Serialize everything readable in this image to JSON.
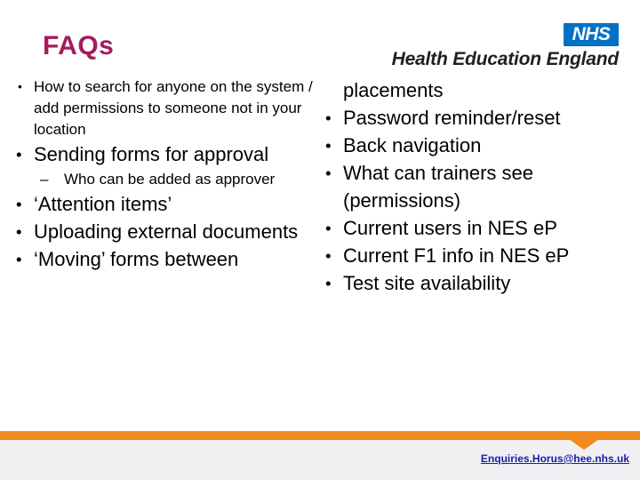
{
  "slide": {
    "title": "FAQs",
    "title_color": "#A51B5E",
    "background_color": "#FFFFFF"
  },
  "logo": {
    "nhs_label": "NHS",
    "organisation": "Health Education England",
    "nhs_blue": "#0072C6"
  },
  "left_column": [
    {
      "level": 1,
      "size": "small",
      "text": "How to search for anyone on the system / add permissions to someone not in your location"
    },
    {
      "level": 1,
      "size": "large",
      "text": "Sending forms for approval"
    },
    {
      "level": 2,
      "size": "small",
      "text": "Who can be added as approver"
    },
    {
      "level": 1,
      "size": "large",
      "text": "‘Attention items’"
    },
    {
      "level": 1,
      "size": "large",
      "text": "Uploading external documents"
    },
    {
      "level": 1,
      "size": "large",
      "text": "‘Moving’ forms between"
    }
  ],
  "right_column": [
    {
      "level": 0,
      "size": "large",
      "text": "placements"
    },
    {
      "level": 1,
      "size": "large",
      "text": "Password reminder/reset"
    },
    {
      "level": 1,
      "size": "large",
      "text": "Back navigation"
    },
    {
      "level": 1,
      "size": "large",
      "text": "What can trainers see (permissions)"
    },
    {
      "level": 1,
      "size": "large",
      "text": "Current users in NES eP"
    },
    {
      "level": 1,
      "size": "large",
      "text": "Current F1 info in NES eP"
    },
    {
      "level": 1,
      "size": "large",
      "text": "Test site availability"
    }
  ],
  "footer": {
    "email": "Enquiries.Horus@hee.nhs.uk",
    "bar_color": "#F18A1E",
    "panel_color": "#F0F0F2",
    "link_color": "#1A1AAE"
  }
}
